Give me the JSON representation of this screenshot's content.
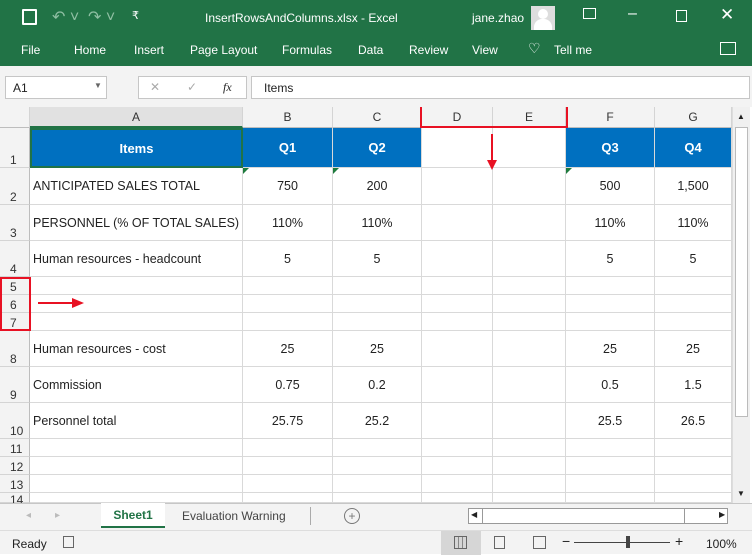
{
  "titlebar": {
    "title": "InsertRowsAndColumns.xlsx  -  Excel",
    "user": "jane.zhao"
  },
  "ribbon": {
    "tabs": [
      "File",
      "Home",
      "Insert",
      "Page Layout",
      "Formulas",
      "Data",
      "Review",
      "View",
      "Tell me"
    ]
  },
  "formula_bar": {
    "name_box": "A1",
    "fx": "fx",
    "value": "Items"
  },
  "columns": [
    "A",
    "B",
    "C",
    "D",
    "E",
    "F",
    "G"
  ],
  "rows": [
    "1",
    "2",
    "3",
    "4",
    "5",
    "6",
    "7",
    "8",
    "9",
    "10",
    "11",
    "12",
    "13",
    "14"
  ],
  "cells": {
    "r1": [
      "Items",
      "Q1",
      "Q2",
      "",
      "",
      "Q3",
      "Q4"
    ],
    "r2": [
      "ANTICIPATED SALES TOTAL",
      "750",
      "200",
      "",
      "",
      "500",
      "1,500"
    ],
    "r3": [
      "PERSONNEL (% OF TOTAL SALES)",
      "110%",
      "110%",
      "",
      "",
      "110%",
      "110%"
    ],
    "r4": [
      "Human resources - headcount",
      "5",
      "5",
      "",
      "",
      "5",
      "5"
    ],
    "r8": [
      "Human resources - cost",
      "25",
      "25",
      "",
      "",
      "25",
      "25"
    ],
    "r9": [
      "Commission",
      "0.75",
      "0.2",
      "",
      "",
      "0.5",
      "1.5"
    ],
    "r10": [
      "Personnel total",
      "25.75",
      "25.2",
      "",
      "",
      "25.5",
      "26.5"
    ]
  },
  "sheets": [
    "Sheet1",
    "Evaluation Warning"
  ],
  "active_sheet": "Sheet1",
  "status": {
    "text": "Ready",
    "zoom": "100%"
  },
  "colors": {
    "excel_green": "#217346",
    "header_blue": "#0070c0",
    "annotation_red": "#e81123"
  }
}
